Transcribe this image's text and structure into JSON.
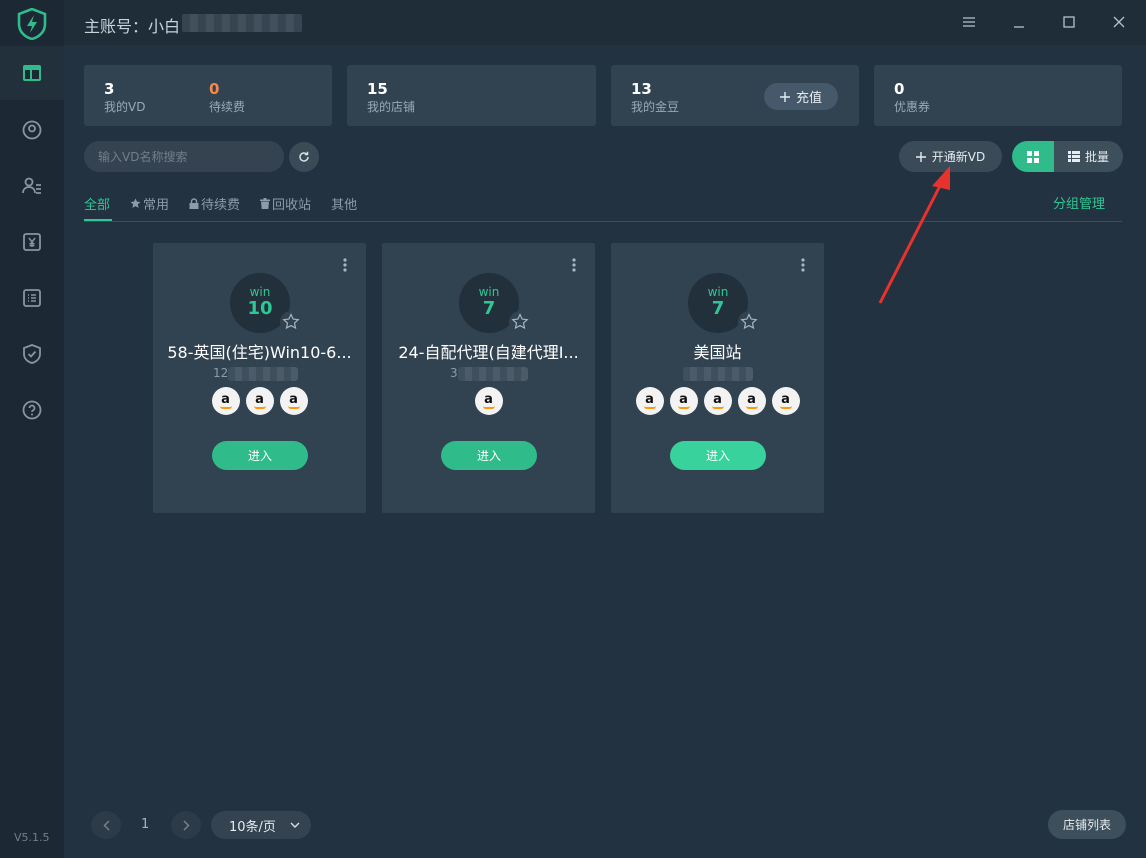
{
  "app": {
    "account_label": "主账号：小白",
    "version": "V5.1.5"
  },
  "sidebar": {
    "items": [
      {
        "icon": "dashboard-icon",
        "active": true
      },
      {
        "icon": "user-circle-icon",
        "active": false
      },
      {
        "icon": "users-icon",
        "active": false
      },
      {
        "icon": "yen-icon",
        "active": false
      },
      {
        "icon": "list-icon",
        "active": false
      },
      {
        "icon": "shield-check-icon",
        "active": false
      },
      {
        "icon": "help-icon",
        "active": false
      }
    ]
  },
  "stats": [
    {
      "value": "3",
      "label": "我的VD"
    },
    {
      "value": "0",
      "label": "待续费"
    },
    {
      "value": "15",
      "label": "我的店铺"
    },
    {
      "value": "13",
      "label": "我的金豆",
      "action": "充值"
    },
    {
      "value": "0",
      "label": "优惠券"
    }
  ],
  "toolbar": {
    "search_placeholder": "输入VD名称搜索",
    "open_vd_label": "开通新VD",
    "batch_label": "批量"
  },
  "tabs": [
    {
      "label": "全部",
      "active": true
    },
    {
      "label": "常用",
      "icon": "star-icon"
    },
    {
      "label": "待续费",
      "icon": "lock-icon"
    },
    {
      "label": "回收站",
      "icon": "trash-icon"
    },
    {
      "label": "其他"
    }
  ],
  "group_management_label": "分组管理",
  "vd_cards": [
    {
      "os": "win",
      "os_version": "10",
      "name": "58-英国(住宅)Win10-6...",
      "sub_prefix": "12",
      "shop_count": 3,
      "enter_label": "进入"
    },
    {
      "os": "win",
      "os_version": "7",
      "name": "24-自配代理(自建代理I...",
      "sub_prefix": "3",
      "shop_count": 1,
      "enter_label": "进入"
    },
    {
      "os": "win",
      "os_version": "7",
      "name": "美国站",
      "sub_prefix": "",
      "shop_count": 5,
      "enter_label": "进入"
    }
  ],
  "shop_logo_letter": "a",
  "pagination": {
    "current_page": "1",
    "per_page": "10条/页"
  },
  "shop_list_label": "店铺列表",
  "colors": {
    "accent": "#2fbc8a",
    "background": "#233240",
    "card": "#314250",
    "warning": "#f08a4b",
    "annotation_arrow": "#e8322d"
  }
}
